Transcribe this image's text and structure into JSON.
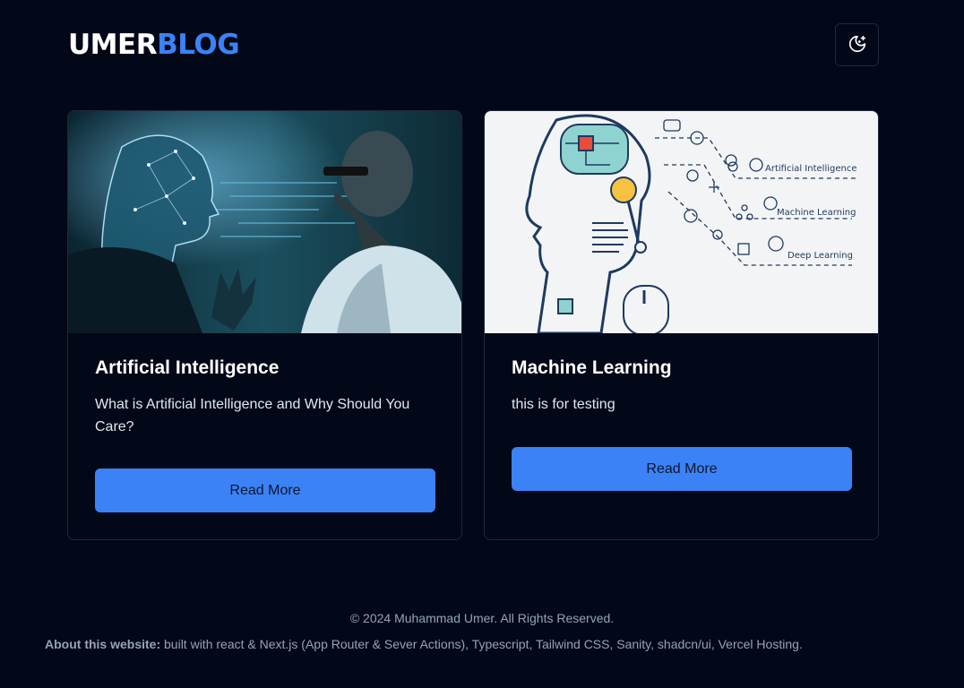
{
  "header": {
    "logo_part1": "UMER",
    "logo_part2": "BLOG",
    "theme_toggle_icon": "moon-stars-icon"
  },
  "colors": {
    "background": "#020817",
    "accent": "#3b82f6",
    "border": "#1e293b",
    "muted_text": "#94a3b8"
  },
  "posts": [
    {
      "image": "ai-human-face-illustration",
      "title": "Artificial Intelligence",
      "description": "What is Artificial Intelligence and Why Should You Care?",
      "button_label": "Read More"
    },
    {
      "image": "ml-robot-head-diagram",
      "title": "Machine Learning",
      "description": "this is for testing",
      "button_label": "Read More",
      "image_labels": [
        "Artificial Intelligence",
        "Machine Learning",
        "Deep Learning"
      ]
    }
  ],
  "footer": {
    "copyright": "© 2024 Muhammad Umer. All Rights Reserved.",
    "about_label": "About this website:",
    "about_text": " built with react & Next.js (App Router & Sever Actions), Typescript, Tailwind CSS, Sanity, shadcn/ui, Vercel Hosting."
  }
}
